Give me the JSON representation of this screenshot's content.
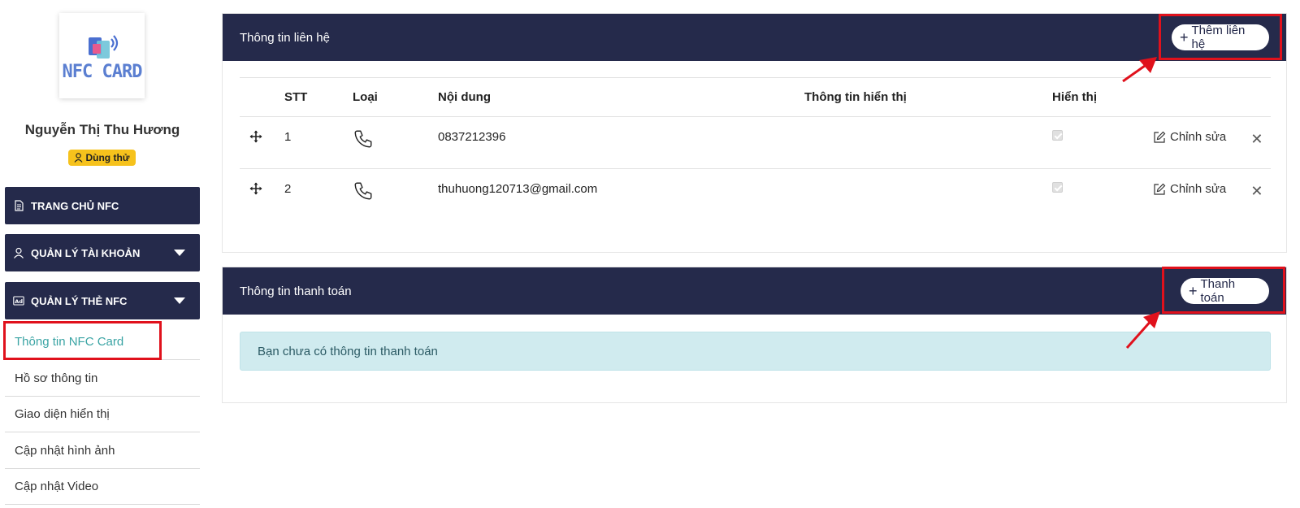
{
  "sidebar": {
    "logo_text": "NFC CARD",
    "user_name": "Nguyễn Thị Thu Hương",
    "trial_badge": "Dùng thử",
    "nav": [
      {
        "label": "TRANG CHỦ NFC",
        "icon": "document-icon"
      },
      {
        "label": "QUẢN LÝ TÀI KHOẢN",
        "icon": "user-icon"
      },
      {
        "label": "QUẢN LÝ THẺ NFC",
        "icon": "ad-icon"
      }
    ],
    "sub_items": [
      {
        "label": "Thông tin NFC Card"
      },
      {
        "label": "Hồ sơ thông tin"
      },
      {
        "label": "Giao diện hiển thị"
      },
      {
        "label": "Cập nhật hình ảnh"
      },
      {
        "label": "Cập nhật Video"
      }
    ]
  },
  "contact_card": {
    "title": "Thông tin liên hệ",
    "add_button": "Thêm liên hệ",
    "columns": [
      "STT",
      "Loại",
      "Nội dung",
      "Thông tin hiển thị",
      "Hiển thị"
    ],
    "rows": [
      {
        "stt": "1",
        "type_icon": "phone-icon",
        "content": "0837212396",
        "display_info": "",
        "visible": true,
        "edit_label": "Chỉnh sửa"
      },
      {
        "stt": "2",
        "type_icon": "phone-icon",
        "content": "thuhuong120713@gmail.com",
        "display_info": "",
        "visible": true,
        "edit_label": "Chỉnh sửa"
      }
    ]
  },
  "payment_card": {
    "title": "Thông tin thanh toán",
    "add_button": "Thanh toán",
    "empty_message": "Bạn chưa có thông tin thanh toán"
  },
  "colors": {
    "header_bg": "#252a4b",
    "highlight_red": "#e0111c",
    "active_teal": "#3aa4a4",
    "badge_yellow": "#f6c21c",
    "alert_bg": "#d0ebef"
  }
}
